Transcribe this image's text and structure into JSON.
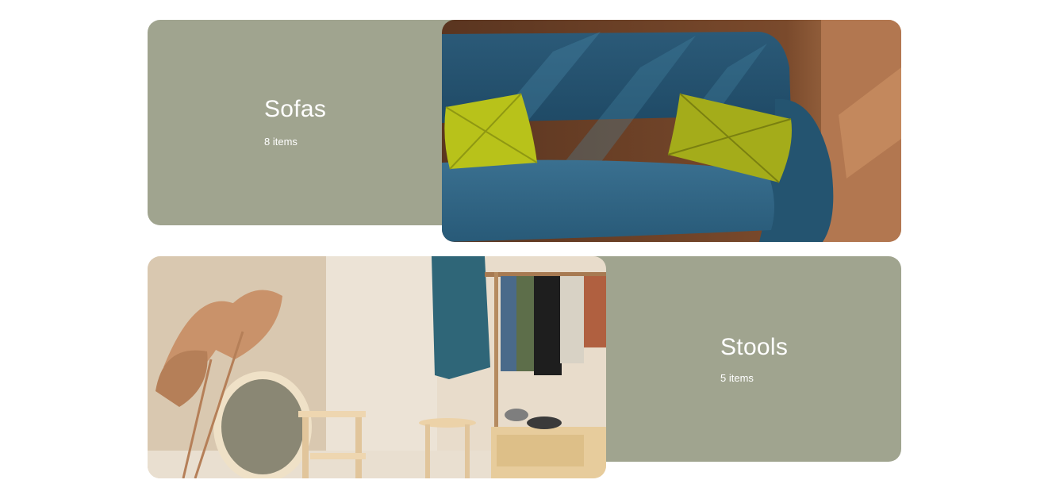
{
  "categories": [
    {
      "title": "Sofas",
      "count": "8 items",
      "image": "blue-velvet-sofa-with-yellow-cushions"
    },
    {
      "title": "Stools",
      "count": "5 items",
      "image": "room-with-wooden-stools-mirror-and-clothes-rack"
    }
  ],
  "colors": {
    "panel": "#a0a48f",
    "text": "#ffffff"
  }
}
